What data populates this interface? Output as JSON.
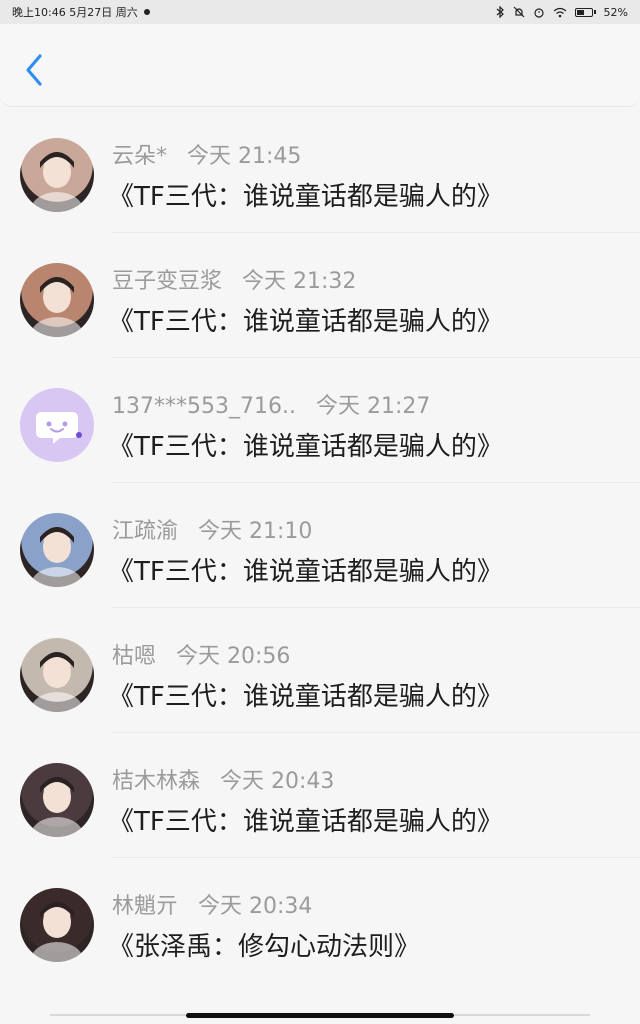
{
  "status_bar": {
    "time_date": "晚上10:46  5月27日 周六",
    "battery": "52%",
    "battery_level": 0.52
  },
  "header": {
    "back_icon": "chevron-left-icon",
    "accent_color": "#2f8ff0"
  },
  "messages": [
    {
      "name": "云朵*",
      "time": "今天 21:45",
      "title": "《TF三代：谁说童话都是骗人的》",
      "avatar_color": "#c9a89a"
    },
    {
      "name": "豆子变豆浆",
      "time": "今天 21:32",
      "title": "《TF三代：谁说童话都是骗人的》",
      "avatar_color": "#b9856f"
    },
    {
      "name": "137***553_716..",
      "time": "今天 21:27",
      "title": "《TF三代：谁说童话都是骗人的》",
      "avatar_color": "#d8c6f3"
    },
    {
      "name": "江疏渝",
      "time": "今天 21:10",
      "title": "《TF三代：谁说童话都是骗人的》",
      "avatar_color": "#8aa2c9"
    },
    {
      "name": "枯嗯",
      "time": "今天 20:56",
      "title": "《TF三代：谁说童话都是骗人的》",
      "avatar_color": "#c4b9ae"
    },
    {
      "name": "桔木林森",
      "time": "今天 20:43",
      "title": "《TF三代：谁说童话都是骗人的》",
      "avatar_color": "#4c3b3e"
    },
    {
      "name": "林魈亓",
      "time": "今天 20:34",
      "title": "《张泽禹：修勾心动法则》",
      "avatar_color": "#3b2a2a"
    }
  ]
}
